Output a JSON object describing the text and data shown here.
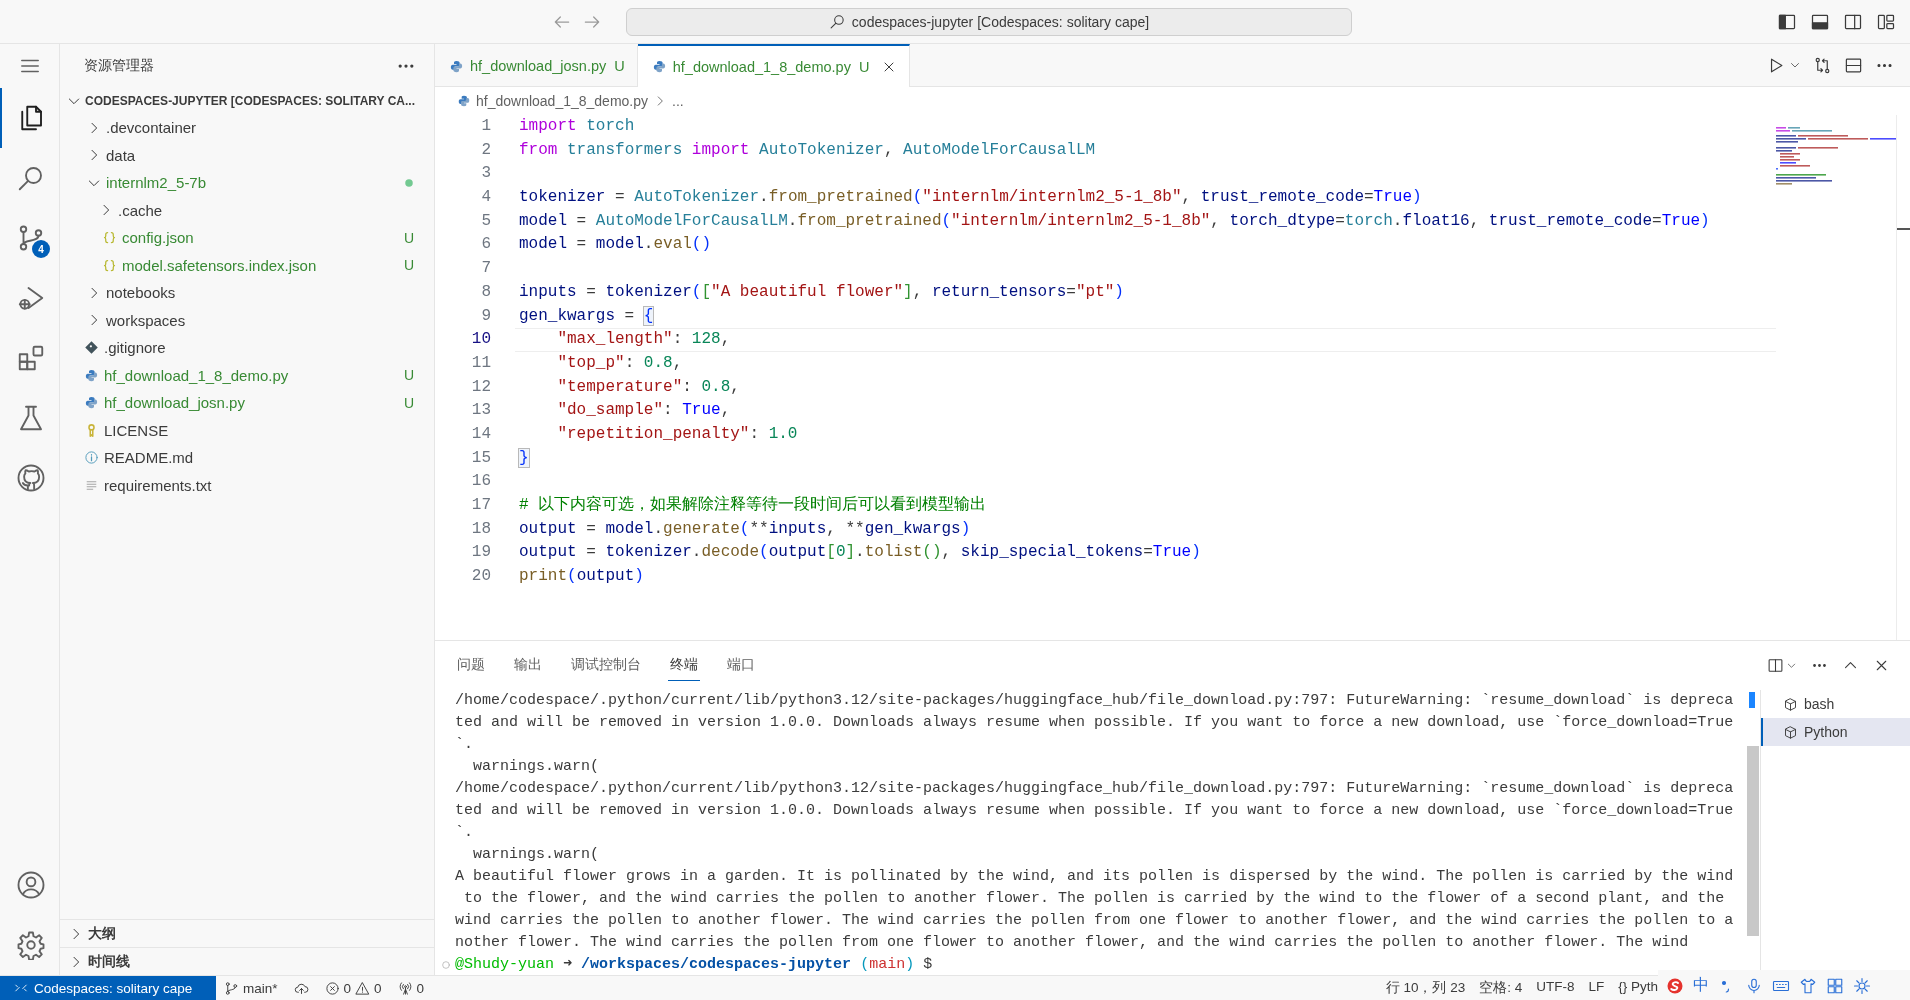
{
  "title_bar": {
    "search": "codespaces-jupyter [Codespaces: solitary cape]"
  },
  "activity_bar": {
    "items": [
      {
        "kind": "explorer",
        "selected": true
      },
      {
        "kind": "search",
        "selected": false
      },
      {
        "kind": "source-control",
        "selected": false,
        "badge": "4"
      },
      {
        "kind": "run-debug",
        "selected": false
      },
      {
        "kind": "extensions",
        "selected": false
      },
      {
        "kind": "testing",
        "selected": false
      },
      {
        "kind": "github",
        "selected": false
      }
    ],
    "bottom": [
      {
        "kind": "account"
      },
      {
        "kind": "settings"
      }
    ]
  },
  "sidebar": {
    "title": "资源管理器",
    "section": "CODESPACES-JUPYTER [CODESPACES: SOLITARY CA...",
    "tree": [
      {
        "label": ".devcontainer",
        "kind": "folder",
        "expanded": false,
        "untracked": false,
        "has_changes": false
      },
      {
        "label": "data",
        "kind": "folder",
        "expanded": false,
        "untracked": false,
        "has_changes": false
      },
      {
        "label": "internlm2_5-7b",
        "kind": "folder",
        "expanded": true,
        "untracked": true,
        "has_changes": true,
        "children": [
          {
            "label": ".cache",
            "kind": "folder",
            "expanded": false,
            "untracked": false,
            "has_changes": false
          },
          {
            "label": "config.json",
            "kind": "json",
            "untracked": true,
            "status": "U"
          },
          {
            "label": "model.safetensors.index.json",
            "kind": "json",
            "untracked": true,
            "status": "U"
          }
        ]
      },
      {
        "label": "notebooks",
        "kind": "folder",
        "expanded": false,
        "untracked": false,
        "has_changes": false
      },
      {
        "label": "workspaces",
        "kind": "folder",
        "expanded": false,
        "untracked": false,
        "has_changes": false
      },
      {
        "label": ".gitignore",
        "kind": "git",
        "untracked": false
      },
      {
        "label": "hf_download_1_8_demo.py",
        "kind": "python",
        "untracked": true,
        "status": "U"
      },
      {
        "label": "hf_download_josn.py",
        "kind": "python",
        "untracked": true,
        "status": "U"
      },
      {
        "label": "LICENSE",
        "kind": "license",
        "untracked": false
      },
      {
        "label": "README.md",
        "kind": "info",
        "untracked": false
      },
      {
        "label": "requirements.txt",
        "kind": "text",
        "untracked": false
      }
    ],
    "collapsed_sections": [
      {
        "label": "大纲",
        "expanded": false
      },
      {
        "label": "时间线",
        "expanded": false
      }
    ]
  },
  "editor": {
    "tabs": [
      {
        "label": "hf_download_josn.py",
        "status": "U",
        "selected": false
      },
      {
        "label": "hf_download_1_8_demo.py",
        "status": "U",
        "selected": true
      }
    ],
    "breadcrumb": [
      "hf_download_1_8_demo.py",
      "..."
    ],
    "lines": [
      {
        "number": "1",
        "current": false,
        "tokens": [
          {
            "kind": "kw",
            "text": "import "
          },
          {
            "kind": "mod",
            "text": "torch"
          }
        ]
      },
      {
        "number": "2",
        "current": false,
        "tokens": [
          {
            "kind": "kw",
            "text": "from "
          },
          {
            "kind": "mod",
            "text": "transformers "
          },
          {
            "kind": "kw",
            "text": "import "
          },
          {
            "kind": "cls",
            "text": "AutoTokenizer"
          },
          {
            "kind": "p",
            "text": ", "
          },
          {
            "kind": "cls",
            "text": "AutoModelForCausalLM"
          }
        ]
      },
      {
        "number": "3",
        "current": false
      },
      {
        "number": "4",
        "current": false,
        "tokens": [
          {
            "kind": "var",
            "text": "tokenizer"
          },
          {
            "kind": "p",
            "text": " = "
          },
          {
            "kind": "cls",
            "text": "AutoTokenizer"
          },
          {
            "kind": "p",
            "text": "."
          },
          {
            "kind": "fn",
            "text": "from_pretrained"
          },
          {
            "kind": "b1",
            "text": "("
          },
          {
            "kind": "str",
            "text": "\"internlm/internlm2_5-1_8b\""
          },
          {
            "kind": "p",
            "text": ", "
          },
          {
            "kind": "var",
            "text": "trust_remote_code"
          },
          {
            "kind": "p",
            "text": "="
          },
          {
            "kind": "const",
            "text": "True"
          },
          {
            "kind": "b1",
            "text": ")"
          }
        ]
      },
      {
        "number": "5",
        "current": false,
        "tokens": [
          {
            "kind": "var",
            "text": "model"
          },
          {
            "kind": "p",
            "text": " = "
          },
          {
            "kind": "cls",
            "text": "AutoModelForCausalLM"
          },
          {
            "kind": "p",
            "text": "."
          },
          {
            "kind": "fn",
            "text": "from_pretrained"
          },
          {
            "kind": "b1",
            "text": "("
          },
          {
            "kind": "str",
            "text": "\"internlm/internlm2_5-1_8b\""
          },
          {
            "kind": "p",
            "text": ", "
          },
          {
            "kind": "var",
            "text": "torch_dtype"
          },
          {
            "kind": "p",
            "text": "="
          },
          {
            "kind": "mod",
            "text": "torch"
          },
          {
            "kind": "p",
            "text": "."
          },
          {
            "kind": "var",
            "text": "float16"
          },
          {
            "kind": "p",
            "text": ", "
          },
          {
            "kind": "var",
            "text": "trust_remote_code"
          },
          {
            "kind": "p",
            "text": "="
          },
          {
            "kind": "const",
            "text": "True"
          },
          {
            "kind": "b1",
            "text": ")"
          }
        ]
      },
      {
        "number": "6",
        "current": false,
        "tokens": [
          {
            "kind": "var",
            "text": "model"
          },
          {
            "kind": "p",
            "text": " = "
          },
          {
            "kind": "var",
            "text": "model"
          },
          {
            "kind": "p",
            "text": "."
          },
          {
            "kind": "fn",
            "text": "eval"
          },
          {
            "kind": "b1",
            "text": "()"
          }
        ]
      },
      {
        "number": "7",
        "current": false
      },
      {
        "number": "8",
        "current": false,
        "tokens": [
          {
            "kind": "var",
            "text": "inputs"
          },
          {
            "kind": "p",
            "text": " = "
          },
          {
            "kind": "var",
            "text": "tokenizer"
          },
          {
            "kind": "b1",
            "text": "("
          },
          {
            "kind": "b2",
            "text": "["
          },
          {
            "kind": "str",
            "text": "\"A beautiful flower\""
          },
          {
            "kind": "b2",
            "text": "]"
          },
          {
            "kind": "p",
            "text": ", "
          },
          {
            "kind": "var",
            "text": "return_tensors"
          },
          {
            "kind": "p",
            "text": "="
          },
          {
            "kind": "str",
            "text": "\"pt\""
          },
          {
            "kind": "b1",
            "text": ")"
          }
        ]
      },
      {
        "number": "9",
        "current": false,
        "tokens": [
          {
            "kind": "var",
            "text": "gen_kwargs"
          },
          {
            "kind": "p",
            "text": " = "
          },
          {
            "kind": "match",
            "text": "{"
          }
        ]
      },
      {
        "number": "10",
        "current": true,
        "tokens": [
          {
            "kind": "str",
            "text": "    \"max_length\""
          },
          {
            "kind": "p",
            "text": ": "
          },
          {
            "kind": "num",
            "text": "128"
          },
          {
            "kind": "p",
            "text": ","
          }
        ]
      },
      {
        "number": "11",
        "current": false,
        "tokens": [
          {
            "kind": "str",
            "text": "    \"top_p\""
          },
          {
            "kind": "p",
            "text": ": "
          },
          {
            "kind": "num",
            "text": "0.8"
          },
          {
            "kind": "p",
            "text": ","
          }
        ]
      },
      {
        "number": "12",
        "current": false,
        "tokens": [
          {
            "kind": "str",
            "text": "    \"temperature\""
          },
          {
            "kind": "p",
            "text": ": "
          },
          {
            "kind": "num",
            "text": "0.8"
          },
          {
            "kind": "p",
            "text": ","
          }
        ]
      },
      {
        "number": "13",
        "current": false,
        "tokens": [
          {
            "kind": "str",
            "text": "    \"do_sample\""
          },
          {
            "kind": "p",
            "text": ": "
          },
          {
            "kind": "const",
            "text": "True"
          },
          {
            "kind": "p",
            "text": ","
          }
        ]
      },
      {
        "number": "14",
        "current": false,
        "tokens": [
          {
            "kind": "str",
            "text": "    \"repetition_penalty\""
          },
          {
            "kind": "p",
            "text": ": "
          },
          {
            "kind": "num",
            "text": "1.0"
          }
        ]
      },
      {
        "number": "15",
        "current": false,
        "tokens": [
          {
            "kind": "match",
            "text": "}"
          }
        ]
      },
      {
        "number": "16",
        "current": false
      },
      {
        "number": "17",
        "current": false,
        "tokens": [
          {
            "kind": "cmt",
            "text": "# 以下内容可选，如果解除注释等待一段时间后可以看到模型输出"
          }
        ]
      },
      {
        "number": "18",
        "current": false,
        "tokens": [
          {
            "kind": "var",
            "text": "output"
          },
          {
            "kind": "p",
            "text": " = "
          },
          {
            "kind": "var",
            "text": "model"
          },
          {
            "kind": "p",
            "text": "."
          },
          {
            "kind": "fn",
            "text": "generate"
          },
          {
            "kind": "b1",
            "text": "("
          },
          {
            "kind": "p",
            "text": "**"
          },
          {
            "kind": "var",
            "text": "inputs"
          },
          {
            "kind": "p",
            "text": ", **"
          },
          {
            "kind": "var",
            "text": "gen_kwargs"
          },
          {
            "kind": "b1",
            "text": ")"
          }
        ]
      },
      {
        "number": "19",
        "current": false,
        "tokens": [
          {
            "kind": "var",
            "text": "output"
          },
          {
            "kind": "p",
            "text": " = "
          },
          {
            "kind": "var",
            "text": "tokenizer"
          },
          {
            "kind": "p",
            "text": "."
          },
          {
            "kind": "fn",
            "text": "decode"
          },
          {
            "kind": "b1",
            "text": "("
          },
          {
            "kind": "var",
            "text": "output"
          },
          {
            "kind": "b2",
            "text": "["
          },
          {
            "kind": "num",
            "text": "0"
          },
          {
            "kind": "b2",
            "text": "]"
          },
          {
            "kind": "p",
            "text": "."
          },
          {
            "kind": "fn",
            "text": "tolist"
          },
          {
            "kind": "b2",
            "text": "()"
          },
          {
            "kind": "p",
            "text": ", "
          },
          {
            "kind": "var",
            "text": "skip_special_tokens"
          },
          {
            "kind": "p",
            "text": "="
          },
          {
            "kind": "const",
            "text": "True"
          },
          {
            "kind": "b1",
            "text": ")"
          }
        ]
      },
      {
        "number": "20",
        "current": false,
        "tokens": [
          {
            "kind": "fn",
            "text": "print"
          },
          {
            "kind": "b1",
            "text": "("
          },
          {
            "kind": "var",
            "text": "output"
          },
          {
            "kind": "b1",
            "text": ")"
          }
        ]
      }
    ]
  },
  "panel": {
    "tabs": [
      {
        "label": "问题",
        "selected": false
      },
      {
        "label": "输出",
        "selected": false
      },
      {
        "label": "调试控制台",
        "selected": false
      },
      {
        "label": "终端",
        "selected": true
      },
      {
        "label": "端口",
        "selected": false
      }
    ],
    "terminal": {
      "lines": [
        "/home/codespace/.python/current/lib/python3.12/site-packages/huggingface_hub/file_download.py:797: FutureWarning: `resume_download` is depreca",
        "ted and will be removed in version 1.0.0. Downloads always resume when possible. If you want to force a new download, use `force_download=True",
        "`.",
        "  warnings.warn(",
        "/home/codespace/.python/current/lib/python3.12/site-packages/huggingface_hub/file_download.py:797: FutureWarning: `resume_download` is depreca",
        "ted and will be removed in version 1.0.0. Downloads always resume when possible. If you want to force a new download, use `force_download=True",
        "`.",
        "  warnings.warn(",
        "A beautiful flower grows in a garden. It is pollinated by the wind, and its pollen is dispersed by the wind. The pollen is carried by the wind",
        " to the flower, and the wind carries the pollen to another flower. The pollen is carried by the wind to the flower of a second plant, and the",
        "wind carries the pollen to another flower. The wind carries the pollen from one flower to another flower, and the wind carries the pollen to a",
        "nother flower. The wind carries the pollen from one flower to another flower, and the wind carries the pollen to another flower. The wind"
      ],
      "prompt": [
        {
          "kind": "user",
          "text": "@Shudy-yuan"
        },
        {
          "kind": "p",
          "text": " ➜ "
        },
        {
          "kind": "path",
          "text": "/workspaces/codespaces-jupyter"
        },
        {
          "kind": "paren",
          "text": " ("
        },
        {
          "kind": "branch",
          "text": "main"
        },
        {
          "kind": "paren",
          "text": ")"
        },
        {
          "kind": "p",
          "text": " $"
        }
      ]
    },
    "terminals": [
      {
        "label": "bash",
        "selected": false
      },
      {
        "label": "Python",
        "selected": true
      }
    ]
  },
  "status_bar": {
    "remote": "Codespaces: solitary cape",
    "branch": "main*",
    "errors": "0",
    "warnings": "0",
    "ports": "0",
    "right": [
      "行 10，列 23",
      "空格: 4",
      "UTF-8",
      "LF",
      "{} Pyth"
    ]
  },
  "ime_toolbar": {
    "mode": "中"
  }
}
